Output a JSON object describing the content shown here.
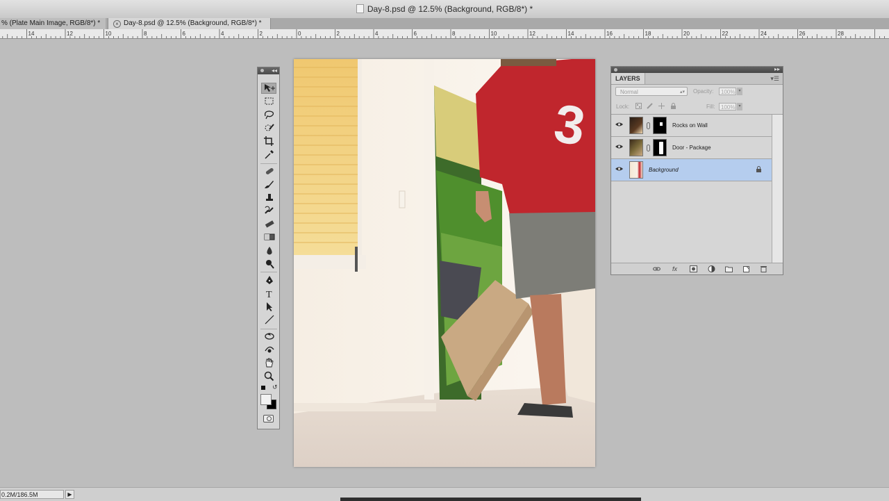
{
  "window": {
    "title": "Day-8.psd @ 12.5% (Background, RGB/8*) *"
  },
  "tabs": [
    {
      "label": "% (Plate Main Image, RGB/8*) *",
      "active": false
    },
    {
      "label": "Day-8.psd @ 12.5% (Background, RGB/8*) *",
      "active": true
    }
  ],
  "ruler": {
    "labels": [
      "14",
      "12",
      "10",
      "8",
      "6",
      "4",
      "2",
      "0",
      "2",
      "4",
      "6",
      "8",
      "10",
      "12",
      "14",
      "16",
      "18",
      "20",
      "22",
      "24",
      "26",
      "28"
    ]
  },
  "toolbox": {
    "tools": [
      "move-tool",
      "marquee-tool",
      "lasso-tool",
      "quick-selection-tool",
      "crop-tool",
      "eyedropper-tool",
      "healing-brush-tool",
      "brush-tool",
      "clone-stamp-tool",
      "history-brush-tool",
      "eraser-tool",
      "gradient-tool",
      "blur-tool",
      "dodge-tool",
      "pen-tool",
      "type-tool",
      "path-selection-tool",
      "line-tool",
      "3d-rotate-tool",
      "3d-orbit-tool",
      "hand-tool",
      "zoom-tool"
    ],
    "selected_tool": "move-tool",
    "foreground_color": "#f2f2f2",
    "background_color": "#000000",
    "type_glyph": "T"
  },
  "layers_panel": {
    "tab_label": "LAYERS",
    "blend_mode": "Normal",
    "opacity_label": "Opacity:",
    "opacity_value": "100%",
    "lock_label": "Lock:",
    "fill_label": "Fill:",
    "fill_value": "100%",
    "layers": [
      {
        "name": "Rocks on Wall",
        "visible": true,
        "has_mask": true,
        "selected": false,
        "locked": false
      },
      {
        "name": "Door - Package",
        "visible": true,
        "has_mask": true,
        "selected": false,
        "locked": false
      },
      {
        "name": "Background",
        "visible": true,
        "has_mask": false,
        "selected": true,
        "locked": true
      }
    ],
    "bottom_icons": [
      "link-layers-icon",
      "fx-icon",
      "add-mask-icon",
      "adjustment-layer-icon",
      "new-group-icon",
      "new-layer-icon",
      "trash-icon"
    ],
    "fx_glyph": "fx"
  },
  "status": {
    "doc_size": "0.2M/186.5M",
    "menu_glyph": "▶"
  },
  "colors": {
    "selection": "#b5cdee",
    "shirt_red": "#c0262d"
  }
}
